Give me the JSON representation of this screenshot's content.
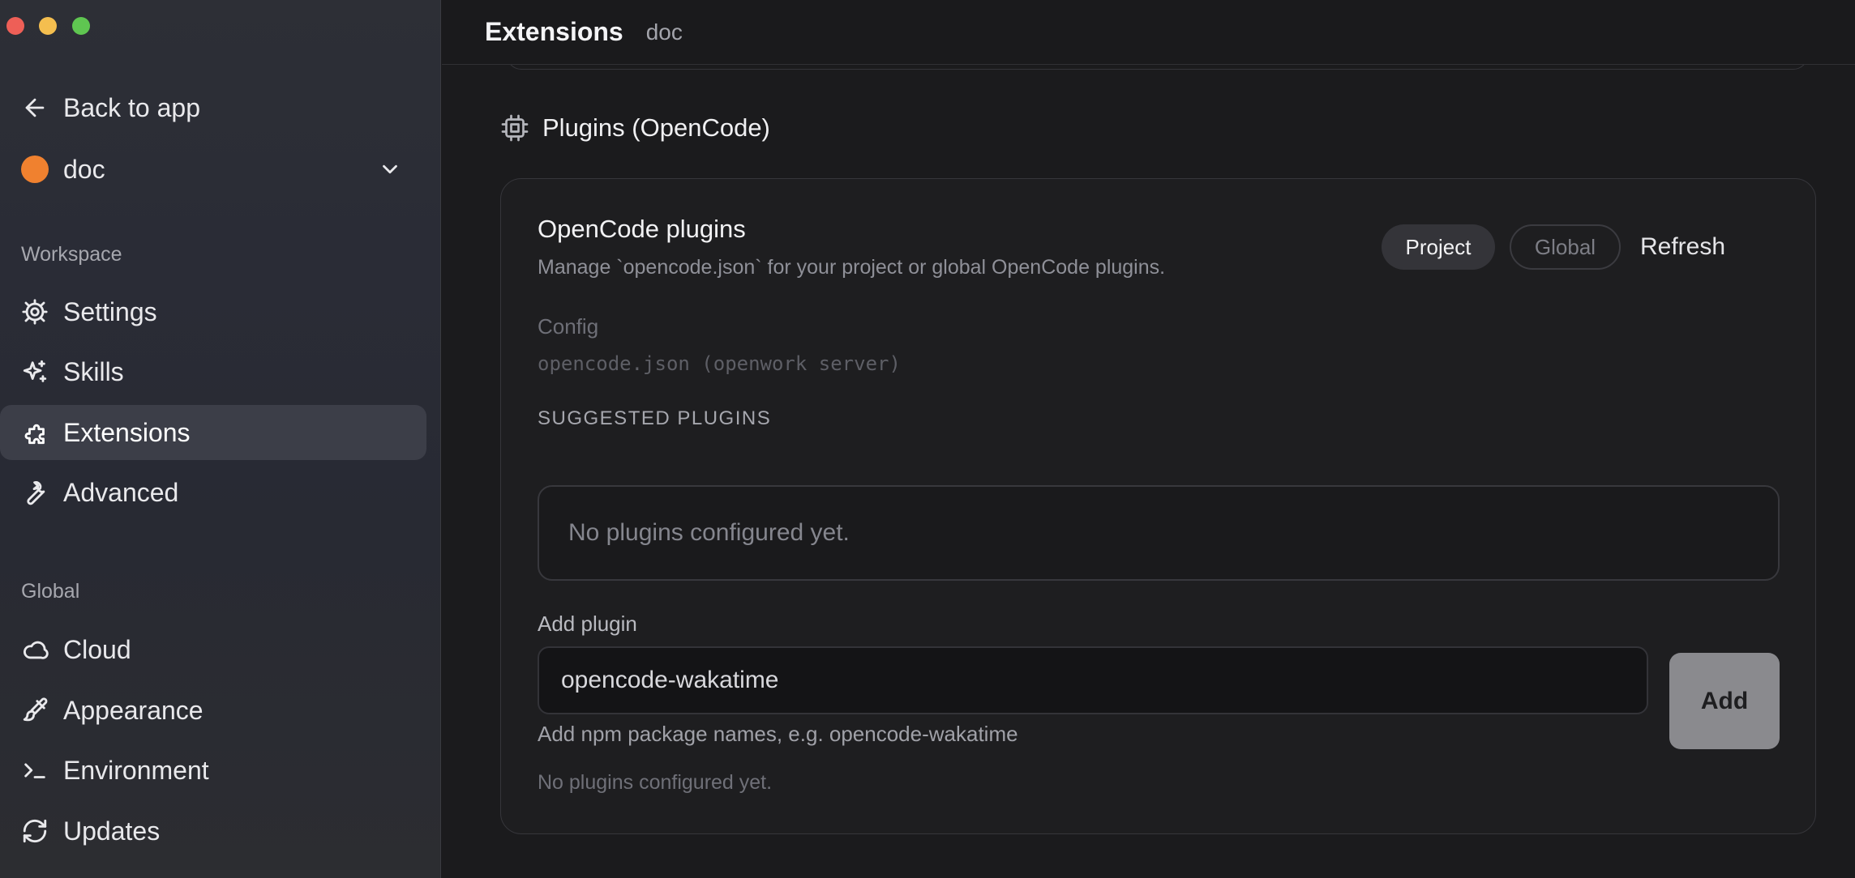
{
  "window": {
    "traffic_lights": [
      "close",
      "minimize",
      "zoom"
    ]
  },
  "sidebar": {
    "back_label": "Back to app",
    "workspace_picker": {
      "name": "doc",
      "color": "#f0812f"
    },
    "workspace_section": "Workspace",
    "workspace_items": [
      {
        "label": "Settings",
        "icon": "gear-icon"
      },
      {
        "label": "Skills",
        "icon": "sparkles-icon"
      },
      {
        "label": "Extensions",
        "icon": "puzzle-icon",
        "active": true
      },
      {
        "label": "Advanced",
        "icon": "wrench-icon"
      }
    ],
    "global_section": "Global",
    "global_items": [
      {
        "label": "Cloud",
        "icon": "cloud-icon"
      },
      {
        "label": "Appearance",
        "icon": "paintbrush-icon"
      },
      {
        "label": "Environment",
        "icon": "terminal-icon"
      },
      {
        "label": "Updates",
        "icon": "refresh-icon"
      }
    ]
  },
  "header": {
    "title": "Extensions",
    "crumb": "doc"
  },
  "main": {
    "section_title": "Plugins (OpenCode)",
    "card": {
      "title": "OpenCode plugins",
      "description": "Manage `opencode.json` for your project or global OpenCode plugins.",
      "scope_options": [
        "Project",
        "Global"
      ],
      "scope_selected": "Project",
      "refresh_label": "Refresh",
      "config_label": "Config",
      "config_path": "opencode.json (openwork server)",
      "suggested_heading": "SUGGESTED PLUGINS",
      "empty_message": "No plugins configured yet.",
      "add_label": "Add plugin",
      "input_value": "opencode-wakatime",
      "add_button": "Add",
      "hint": "Add npm package names, e.g. opencode-wakatime",
      "footer_note": "No plugins configured yet."
    }
  }
}
